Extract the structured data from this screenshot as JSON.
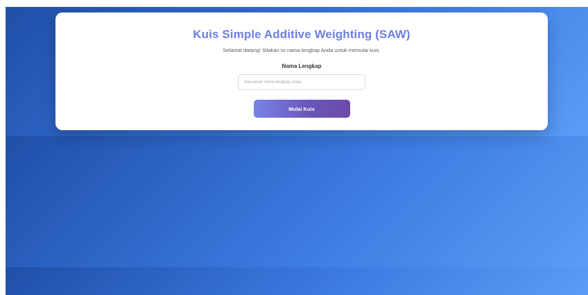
{
  "quiz": {
    "title": "Kuis Simple Additive Weighting (SAW)",
    "welcome_text": "Selamat datang! Silakan isi nama lengkap Anda untuk memulai kuis.",
    "name_label": "Nama Lengkap",
    "name_placeholder": "Masukkan nama lengkap Anda",
    "name_value": "",
    "start_button_label": "Mulai Kuis"
  },
  "colors": {
    "title": "#6a7fe0",
    "button_start": "#7784e6",
    "button_end": "#6c4aa8",
    "background_start": "#1f4fa8",
    "background_end": "#5a9cf5"
  }
}
